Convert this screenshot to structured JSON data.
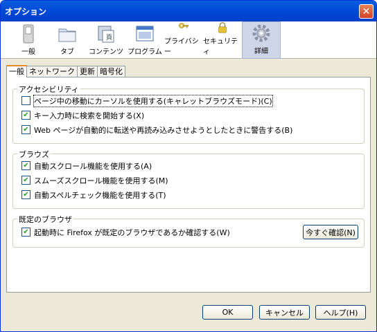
{
  "window": {
    "title": "オプション",
    "close_label": "✕"
  },
  "toolbar": {
    "items": [
      {
        "label": "一般",
        "icon": "switch-icon"
      },
      {
        "label": "タブ",
        "icon": "folder-icon"
      },
      {
        "label": "コンテンツ",
        "icon": "document-icon"
      },
      {
        "label": "プログラム",
        "icon": "window-icon"
      },
      {
        "label": "プライバシー",
        "icon": "key-icon"
      },
      {
        "label": "セキュリティ",
        "icon": "lock-icon"
      },
      {
        "label": "詳細",
        "icon": "gear-icon",
        "selected": true
      }
    ]
  },
  "tabs": [
    "一般",
    "ネットワーク",
    "更新",
    "暗号化"
  ],
  "groups": {
    "accessibility": {
      "label": "アクセシビリティ",
      "items": [
        {
          "label": "ページ中の移動にカーソルを使用する(キャレットブラウズモード)(C)",
          "checked": false
        },
        {
          "label": "キー入力時に検索を開始する(X)",
          "checked": true
        },
        {
          "label": "Web ページが自動的に転送や再読み込みさせようとしたときに警告する(B)",
          "checked": true
        }
      ]
    },
    "browsing": {
      "label": "ブラウズ",
      "items": [
        {
          "label": "自動スクロール機能を使用する(A)",
          "checked": true
        },
        {
          "label": "スムーズスクロール機能を使用する(M)",
          "checked": true
        },
        {
          "label": "自動スペルチェック機能を使用する(T)",
          "checked": true
        }
      ]
    },
    "default_browser": {
      "label": "既定のブラウザ",
      "item": {
        "label": "起動時に Firefox が既定のブラウザであるか確認する(W)",
        "checked": true
      },
      "check_now": "今すぐ確認(N)"
    }
  },
  "footer": {
    "ok": "OK",
    "cancel": "キャンセル",
    "help": "ヘルプ(H)"
  }
}
